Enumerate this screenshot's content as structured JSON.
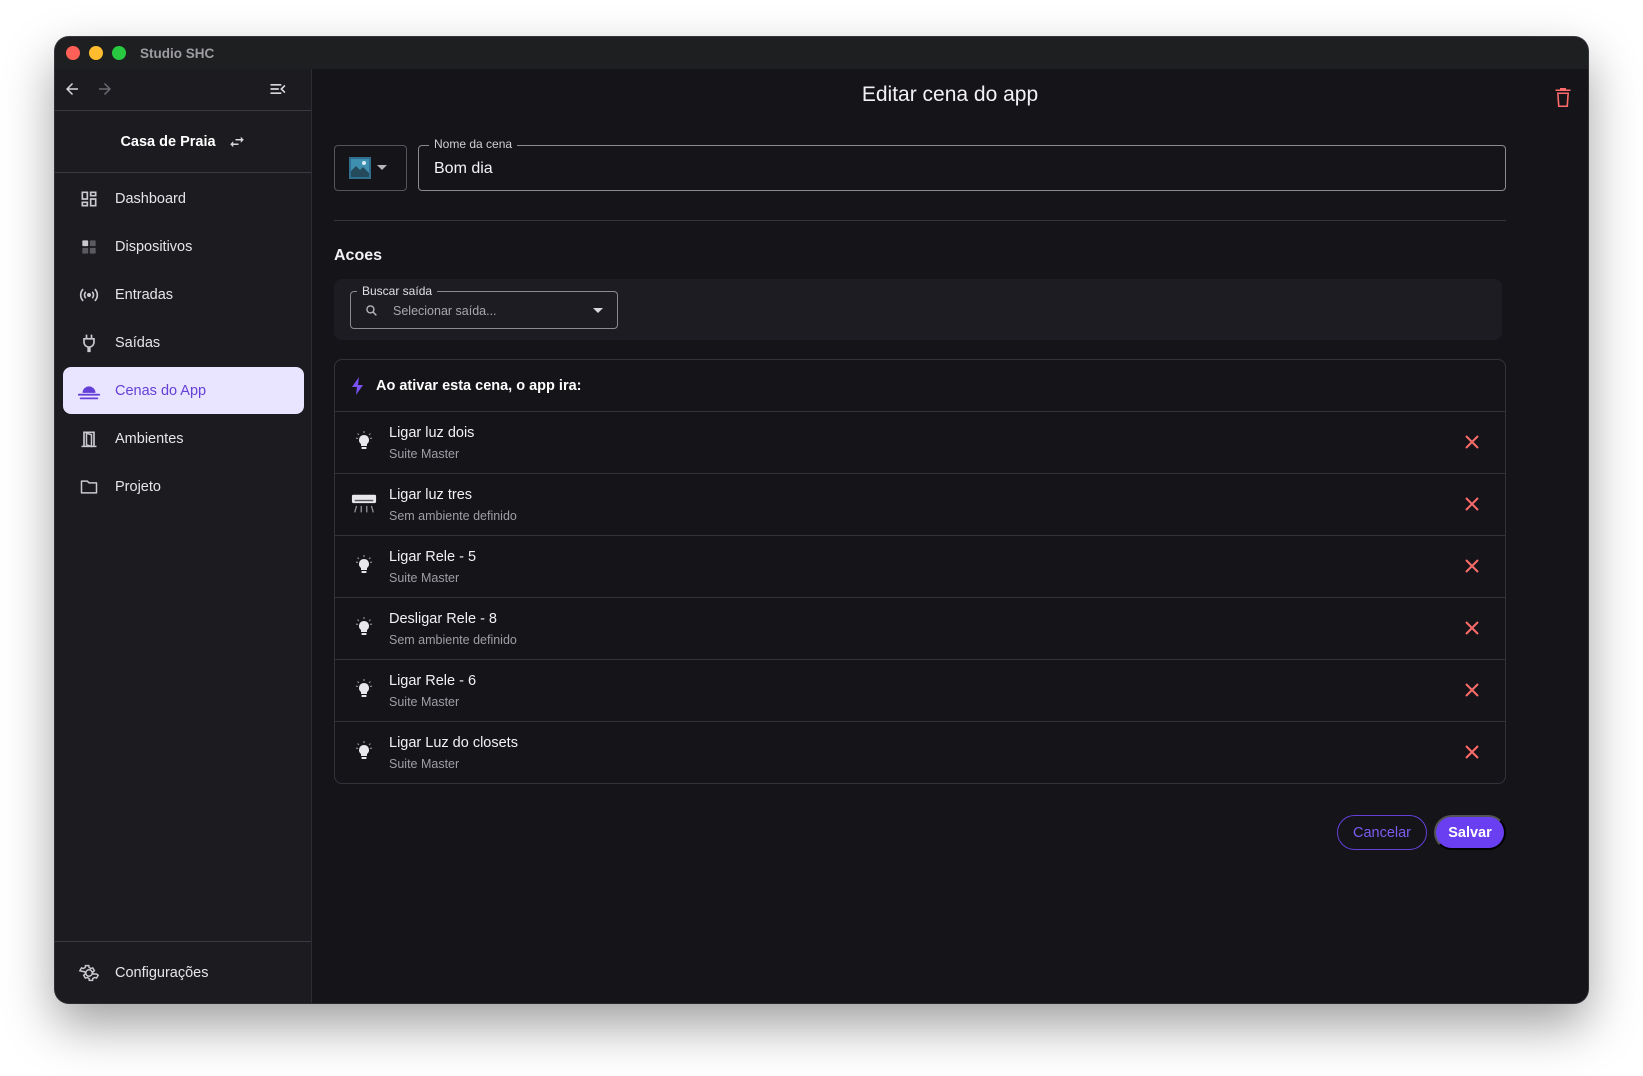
{
  "window": {
    "title": "Studio SHC"
  },
  "sidebar": {
    "project_name": "Casa de Praia",
    "items": [
      {
        "label": "Dashboard",
        "icon": "dashboard-icon"
      },
      {
        "label": "Dispositivos",
        "icon": "devices-icon"
      },
      {
        "label": "Entradas",
        "icon": "broadcast-icon"
      },
      {
        "label": "Saídas",
        "icon": "plug-icon"
      },
      {
        "label": "Cenas do App",
        "icon": "cloud-icon",
        "active": true
      },
      {
        "label": "Ambientes",
        "icon": "door-icon"
      },
      {
        "label": "Projeto",
        "icon": "folder-icon"
      }
    ],
    "settings_label": "Configurações"
  },
  "page": {
    "title": "Editar cena do app",
    "scene_name_label": "Nome da cena",
    "scene_name_value": "Bom dia",
    "actions_title": "Acoes",
    "search_label": "Buscar saída",
    "search_placeholder": "Selecionar saída...",
    "card_header": "Ao ativar esta cena, o app ira:",
    "actions": [
      {
        "title": "Ligar luz dois",
        "subtitle": "Suite Master",
        "icon": "lightbulb-icon"
      },
      {
        "title": "Ligar luz tres",
        "subtitle": "Sem ambiente definido",
        "icon": "air-conditioner-icon"
      },
      {
        "title": "Ligar Rele - 5",
        "subtitle": "Suite Master",
        "icon": "lightbulb-icon"
      },
      {
        "title": "Desligar Rele - 8",
        "subtitle": "Sem ambiente definido",
        "icon": "lightbulb-icon"
      },
      {
        "title": "Ligar Rele - 6",
        "subtitle": "Suite Master",
        "icon": "lightbulb-icon"
      },
      {
        "title": "Ligar Luz do closets",
        "subtitle": "Suite Master",
        "icon": "lightbulb-icon"
      }
    ],
    "cancel_label": "Cancelar",
    "save_label": "Salvar"
  },
  "colors": {
    "accent": "#6a3ff2",
    "active_bg": "#e9e4ff",
    "danger": "#ff6b6b",
    "background": "#141419"
  }
}
